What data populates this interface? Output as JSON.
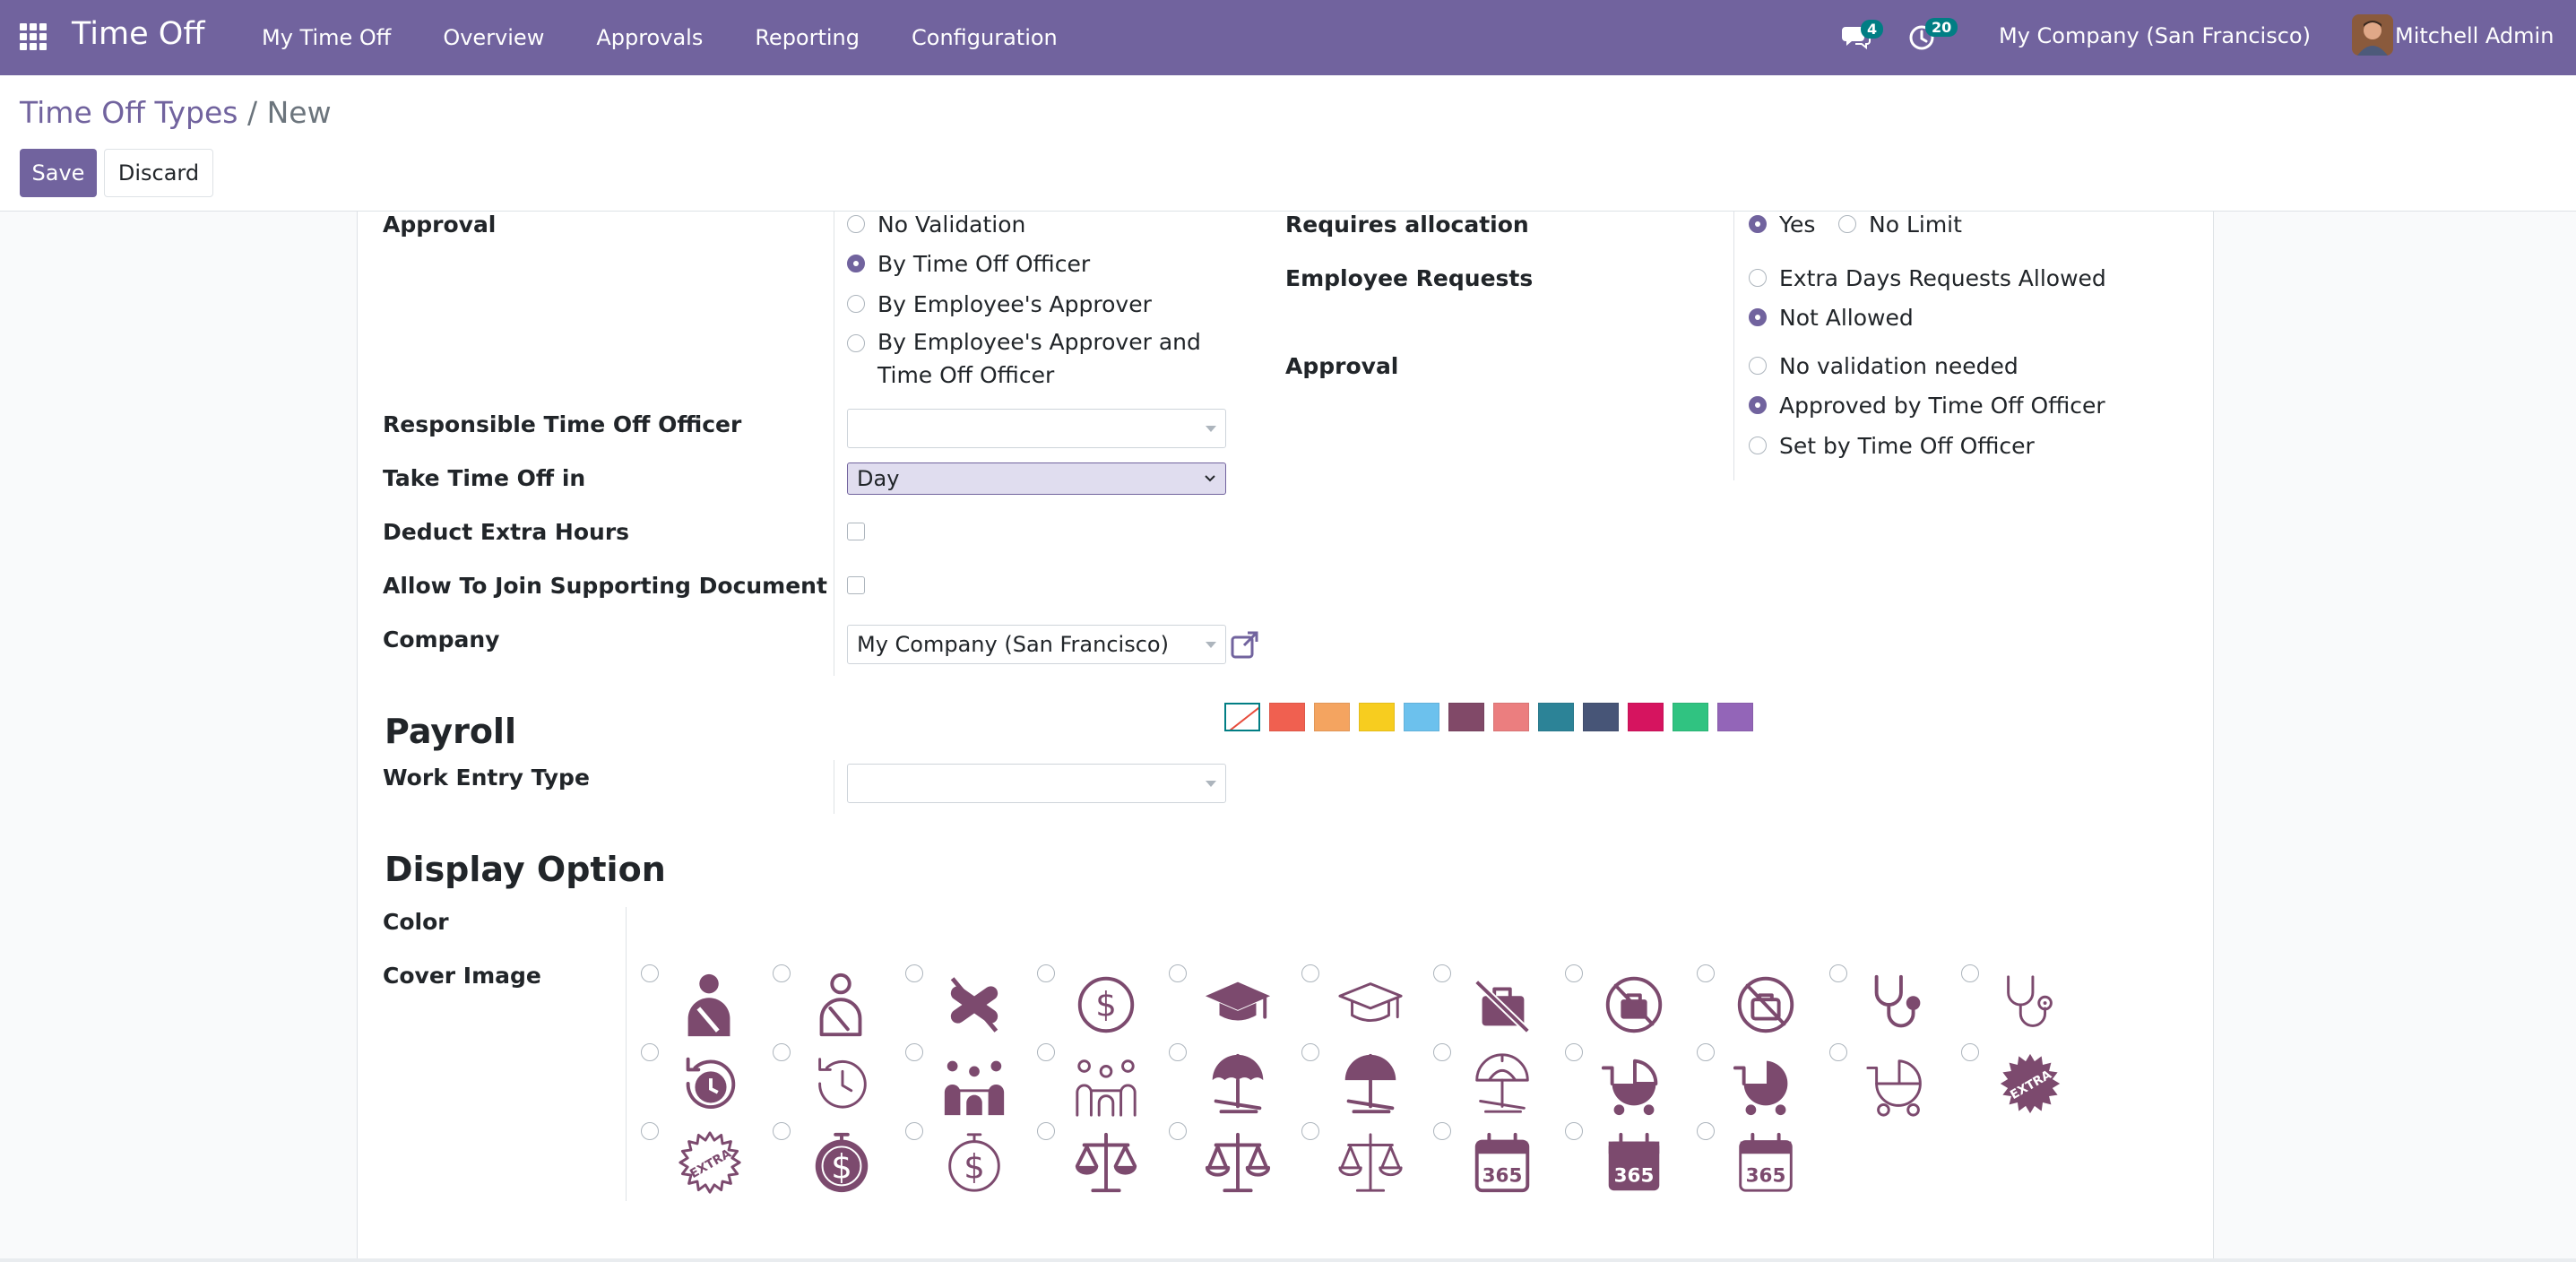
{
  "navbar": {
    "app_title": "Time Off",
    "menu": [
      "My Time Off",
      "Overview",
      "Approvals",
      "Reporting",
      "Configuration"
    ],
    "chat_count": "4",
    "activity_count": "20",
    "company": "My Company (San Francisco)",
    "user": "Mitchell Admin"
  },
  "breadcrumb": {
    "parent": "Time Off Types",
    "separator": "/",
    "current": "New"
  },
  "buttons": {
    "save": "Save",
    "discard": "Discard"
  },
  "form": {
    "approval_label": "Approval",
    "approval_options": [
      "No Validation",
      "By Time Off Officer",
      "By Employee's Approver",
      "By Employee's Approver and",
      "Time Off Officer"
    ],
    "approval_selected": "By Time Off Officer",
    "responsible_label": "Responsible Time Off Officer",
    "responsible_value": "",
    "take_time_off_label": "Take Time Off in",
    "take_time_off_value": "Day",
    "deduct_extra_hours_label": "Deduct Extra Hours",
    "supporting_doc_label": "Allow To Join Supporting Document",
    "company_label": "Company",
    "company_value": "My Company (San Francisco)",
    "requires_allocation_label": "Requires allocation",
    "requires_allocation_options": [
      "Yes",
      "No Limit"
    ],
    "employee_requests_label": "Employee Requests",
    "employee_requests_options": [
      "Extra Days Requests Allowed",
      "Not Allowed"
    ],
    "alloc_approval_label": "Approval",
    "alloc_approval_options": [
      "No validation needed",
      "Approved by Time Off Officer",
      "Set by Time Off Officer"
    ]
  },
  "payroll": {
    "title": "Payroll",
    "work_entry_label": "Work Entry Type",
    "work_entry_value": ""
  },
  "display": {
    "title": "Display Option",
    "color_label": "Color",
    "cover_label": "Cover Image",
    "colors": [
      "#f06050",
      "#f4a460",
      "#f7cd1f",
      "#6cc1ed",
      "#814968",
      "#eb7e7f",
      "#2c8397",
      "#475577",
      "#d6145f",
      "#30c381",
      "#9365b8"
    ],
    "icon_color": "#7c4a6e",
    "cover_icons": [
      "injured-person-icon",
      "injured-person-outline-icon",
      "crossed-bandage-icon",
      "dollar-circle-icon",
      "graduation-cap-icon",
      "graduation-cap-outline-icon",
      "no-suitcase-icon",
      "no-suitcase-circle-icon",
      "no-suitcase-circle-outline-icon",
      "stethoscope-icon",
      "stethoscope-outline-icon",
      "history-clock-icon",
      "history-clock-outline-icon",
      "family-icon",
      "family-outline-icon",
      "beach-umbrella-icon",
      "beach-umbrella-filled-icon",
      "beach-umbrella-outline-icon",
      "baby-stroller-icon",
      "baby-stroller-filled-icon",
      "baby-stroller-outline-icon",
      "extra-badge-icon",
      "extra-badge-outline-icon",
      "dollar-stopwatch-icon",
      "dollar-stopwatch-outline-icon",
      "balance-scale-icon",
      "balance-scale-outline-icon",
      "balance-scale-thin-icon",
      "calendar-365-icon",
      "calendar-365-filled-icon",
      "calendar-365-outline-icon"
    ],
    "calendar_text": "365",
    "extra_text": "EXTRA"
  }
}
